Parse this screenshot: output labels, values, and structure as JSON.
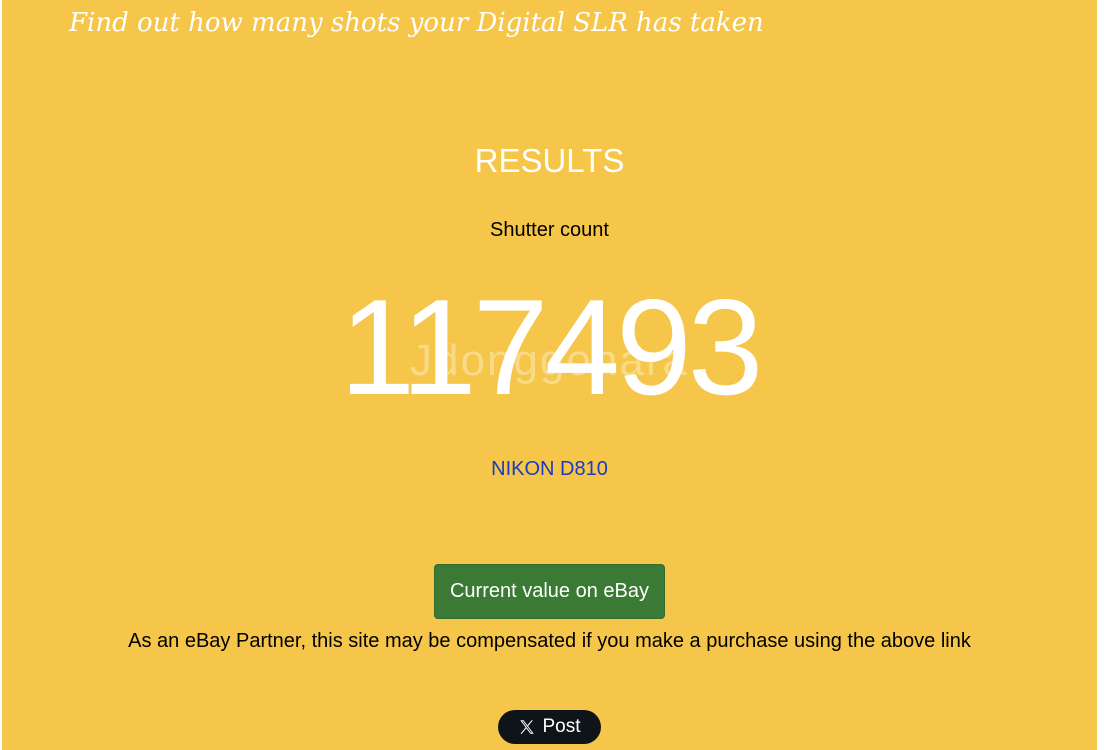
{
  "header": {
    "tagline": "Find out how many shots your Digital SLR has taken"
  },
  "results": {
    "title": "RESULTS",
    "count_label": "Shutter count",
    "count_value": "117493",
    "camera_model": "NIKON D810"
  },
  "ebay": {
    "button_label": "Current value on eBay",
    "disclaimer": "As an eBay Partner, this site may be compensated if you make a purchase using the above link"
  },
  "share": {
    "post_label": "Post",
    "icon": "x-logo-icon"
  },
  "watermark": {
    "text": "Jdonggonara"
  },
  "colors": {
    "background": "#f5c649",
    "ebay_button": "#3a7a35",
    "link": "#1a3cc4",
    "post_button": "#0f1419"
  }
}
